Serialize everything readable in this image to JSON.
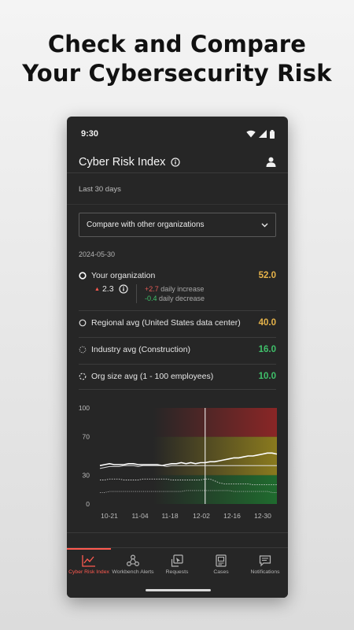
{
  "headline": {
    "line1": "Check and Compare",
    "line2": "Your Cybersecurity Risk"
  },
  "status_bar": {
    "time": "9:30"
  },
  "app_bar": {
    "title": "Cyber Risk Index",
    "info_icon": "info-icon",
    "account_icon": "user-icon"
  },
  "period_label": "Last 30 days",
  "compare_dropdown": {
    "selected": "Compare with other organizations"
  },
  "date": "2024-05-30",
  "comparison_rows": [
    {
      "label": "Your organization",
      "value": "52.0",
      "color": "#e6b34a",
      "marker": "ring-solid-white"
    },
    {
      "label": "Regional avg (United States data center)",
      "value": "40.0",
      "color": "#e6b34a",
      "marker": "ring-solid"
    },
    {
      "label": "Industry avg (Construction)",
      "value": "16.0",
      "color": "#3fc06a",
      "marker": "ring-dotted"
    },
    {
      "label": "Org size avg (1 - 100 employees)",
      "value": "10.0",
      "color": "#3fc06a",
      "marker": "ring-dashed"
    }
  ],
  "your_org_change": {
    "value": "2.3",
    "direction": "up",
    "daily_increase_value": "+2.7",
    "daily_increase_label": "daily increase",
    "daily_decrease_value": "-0.4",
    "daily_decrease_label": "daily decrease"
  },
  "chart_data": {
    "type": "line",
    "x_ticks": [
      "10-21",
      "11-04",
      "11-18",
      "12-02",
      "12-16",
      "12-30"
    ],
    "y_ticks": [
      0,
      30,
      70,
      100
    ],
    "ylim": [
      0,
      100
    ],
    "risk_bands": [
      {
        "from": 0,
        "to": 30,
        "color": "#1f6b2e"
      },
      {
        "from": 30,
        "to": 70,
        "color": "#8a7a1e"
      },
      {
        "from": 70,
        "to": 100,
        "color": "#8a2626"
      }
    ],
    "cursor_x_index": 22,
    "series": [
      {
        "name": "Your organization",
        "style": "solid",
        "values": [
          40,
          41,
          42,
          41,
          41,
          41,
          42,
          42,
          41,
          41,
          41,
          41,
          41,
          40,
          41,
          42,
          42,
          43,
          42,
          43,
          42,
          43,
          43,
          44,
          44,
          45,
          46,
          47,
          48,
          48,
          49,
          50,
          50,
          51,
          52,
          53,
          53,
          52
        ]
      },
      {
        "name": "Regional avg (United States data center)",
        "style": "solid",
        "values": [
          37,
          38,
          39,
          39,
          39,
          40,
          40,
          40,
          39,
          40,
          40,
          40,
          40,
          40,
          39,
          40,
          40,
          40,
          40,
          40,
          40,
          40,
          40,
          40,
          40,
          40,
          40,
          40,
          40,
          40,
          40,
          40,
          40,
          40,
          40,
          40,
          40,
          40
        ]
      },
      {
        "name": "Industry avg (Construction)",
        "style": "dotted",
        "values": [
          25,
          25,
          26,
          26,
          26,
          25,
          25,
          25,
          25,
          26,
          26,
          26,
          26,
          26,
          26,
          25,
          25,
          25,
          25,
          25,
          25,
          25,
          26,
          26,
          24,
          22,
          21,
          21,
          21,
          21,
          21,
          21,
          20,
          20,
          20,
          20,
          20,
          20
        ]
      },
      {
        "name": "Org size avg (1 - 100 employees)",
        "style": "dotted",
        "values": [
          12,
          12,
          13,
          13,
          13,
          13,
          13,
          13,
          13,
          13,
          13,
          13,
          13,
          13,
          13,
          13,
          13,
          13,
          14,
          14,
          14,
          14,
          14,
          14,
          14,
          14,
          14,
          14,
          13,
          13,
          13,
          13,
          13,
          13,
          13,
          13,
          12,
          12
        ]
      }
    ]
  },
  "bottom_nav": [
    {
      "label": "Cyber Risk Index",
      "icon": "trend-chart-icon",
      "active": true
    },
    {
      "label": "Workbench Alerts",
      "icon": "network-nodes-icon",
      "active": false
    },
    {
      "label": "Requests",
      "icon": "request-cursor-icon",
      "active": false
    },
    {
      "label": "Cases",
      "icon": "document-icon",
      "active": false
    },
    {
      "label": "Notifications",
      "icon": "message-icon",
      "active": false
    }
  ],
  "colors": {
    "accent": "#ff5a50",
    "background": "#262626",
    "increase": "#e45a56",
    "decrease": "#3fc06a"
  }
}
